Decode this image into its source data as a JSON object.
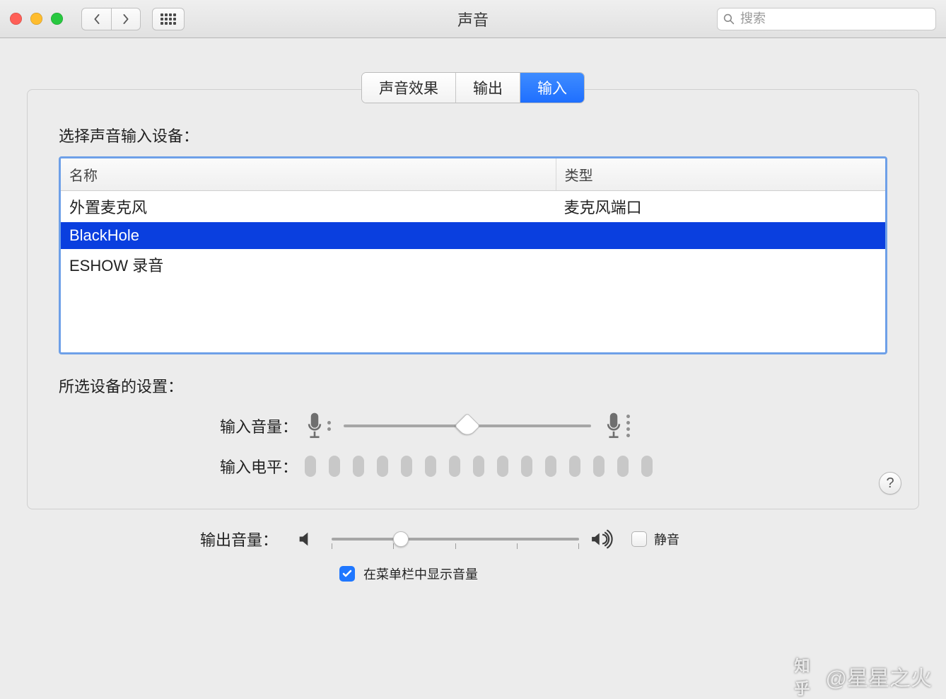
{
  "window": {
    "title": "声音"
  },
  "search": {
    "placeholder": "搜索"
  },
  "tabs": [
    {
      "label": "声音效果",
      "active": false
    },
    {
      "label": "输出",
      "active": false
    },
    {
      "label": "输入",
      "active": true
    }
  ],
  "input_device": {
    "section_label": "选择声音输入设备：",
    "columns": {
      "name": "名称",
      "type": "类型"
    },
    "rows": [
      {
        "name": "外置麦克风",
        "type": "麦克风端口",
        "selected": false
      },
      {
        "name": "BlackHole",
        "type": "",
        "selected": true
      },
      {
        "name": "ESHOW 录音",
        "type": "",
        "selected": false
      }
    ]
  },
  "selected_device": {
    "section_label": "所选设备的设置：",
    "input_volume_label": "输入音量：",
    "input_volume_percent": 50,
    "input_level_label": "输入电平：",
    "input_level_segments": 15,
    "input_level_active": 0
  },
  "output": {
    "label": "输出音量：",
    "percent": 28,
    "mute_label": "静音",
    "mute_checked": false,
    "show_in_menubar_label": "在菜单栏中显示音量",
    "show_in_menubar_checked": true
  },
  "watermark": {
    "brand": "知乎",
    "user": "@星星之火"
  }
}
